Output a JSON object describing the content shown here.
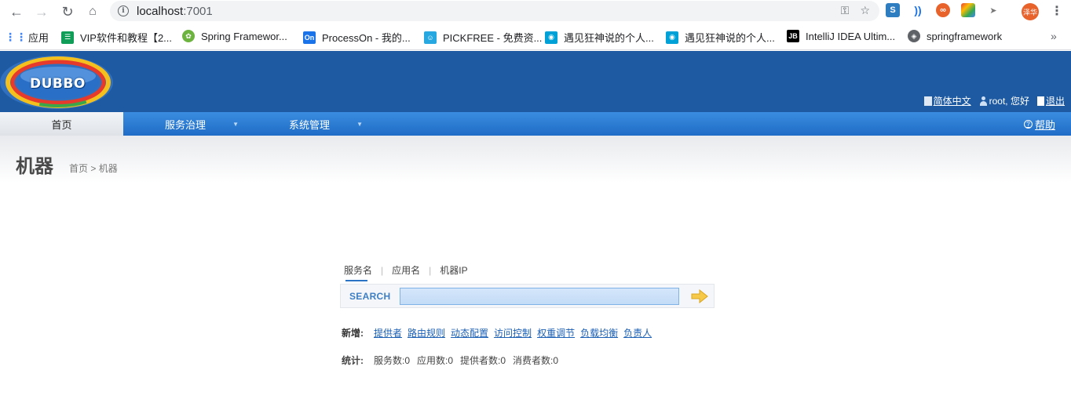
{
  "browser": {
    "url_host": "localhost",
    "url_port": ":7001",
    "profile_label": "泽华",
    "bookmarks": [
      {
        "label": "应用",
        "color": "#4285f4"
      },
      {
        "label": "VIP软件和教程【2...",
        "color": "#0f9d58"
      },
      {
        "label": "Spring Framewor...",
        "color": "#6db33f"
      },
      {
        "label": "ProcessOn - 我的...",
        "color": "#1a73e8"
      },
      {
        "label": "PICKFREE - 免费资...",
        "color": "#27a8e0"
      },
      {
        "label": "遇见狂神说的个人...",
        "color": "#00a1d6"
      },
      {
        "label": "遇见狂神说的个人...",
        "color": "#00a1d6"
      },
      {
        "label": "IntelliJ IDEA Ultim...",
        "color": "#000000"
      },
      {
        "label": "springframework",
        "color": "#5f6368"
      }
    ]
  },
  "header": {
    "logo_text": "DUBBO",
    "language": "简体中文",
    "greeting": "root, 您好",
    "logout": "退出"
  },
  "nav": {
    "home": "首页",
    "service_governance": "服务治理",
    "system_admin": "系统管理",
    "help": "帮助"
  },
  "page": {
    "title": "机器",
    "breadcrumb_home": "首页",
    "breadcrumb_sep": ">",
    "breadcrumb_current": "机器"
  },
  "search": {
    "tabs": [
      "服务名",
      "应用名",
      "机器IP"
    ],
    "label": "SEARCH",
    "value": ""
  },
  "add": {
    "label": "新增:",
    "links": [
      "提供者",
      "路由规则",
      "动态配置",
      "访问控制",
      "权重调节",
      "负载均衡",
      "负责人"
    ]
  },
  "stats": {
    "label": "统计:",
    "items": [
      "服务数:0",
      "应用数:0",
      "提供者数:0",
      "消费者数:0"
    ]
  },
  "colors": {
    "header_blue": "#1e5aa2",
    "nav_blue": "#2b7bd6",
    "link_blue": "#1b5fb5"
  }
}
